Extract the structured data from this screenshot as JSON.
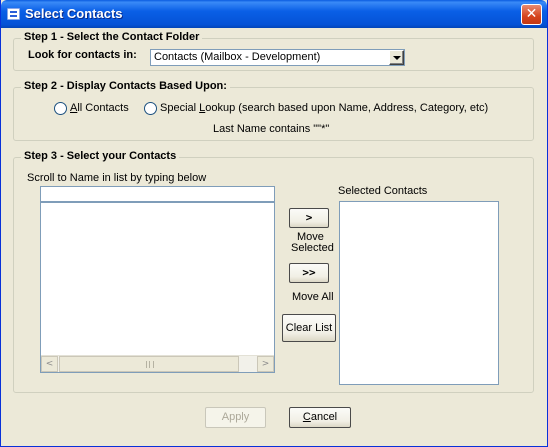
{
  "window": {
    "title": "Select Contacts",
    "close_glyph": "✕"
  },
  "step1": {
    "title": "Step 1 - Select the Contact Folder",
    "look_label": "Look for contacts in:",
    "folder_value": "Contacts (Mailbox - Development)"
  },
  "step2": {
    "title": "Step 2 - Display Contacts Based Upon:",
    "all_contacts_prefix": "",
    "all_contacts_u": "A",
    "all_contacts_rest": "ll Contacts",
    "special_prefix": "Special ",
    "special_u": "L",
    "special_rest": "ookup (search based upon Name, Address, Category, etc)",
    "filter_text": "Last Name contains \"\"*\"",
    "selected": "none"
  },
  "step3": {
    "title": "Step 3 - Select your Contacts",
    "scroll_label": "Scroll to Name in list by typing below",
    "scroll_input_value": "",
    "selected_label": "Selected Contacts",
    "move_selected_glyph": ">",
    "move_selected_label_line1": "Move",
    "move_selected_label_line2": "Selected",
    "move_all_glyph": ">>",
    "move_all_label": "Move All",
    "clear_list_label": "Clear List",
    "scroll_left_glyph": "<",
    "scroll_right_glyph": ">"
  },
  "footer": {
    "apply_label": "Apply",
    "cancel_u": "C",
    "cancel_rest": "ancel"
  },
  "colors": {
    "titlebar": "#0552d6",
    "dialog_bg": "#ece9d8",
    "close_button": "#d6431c"
  }
}
